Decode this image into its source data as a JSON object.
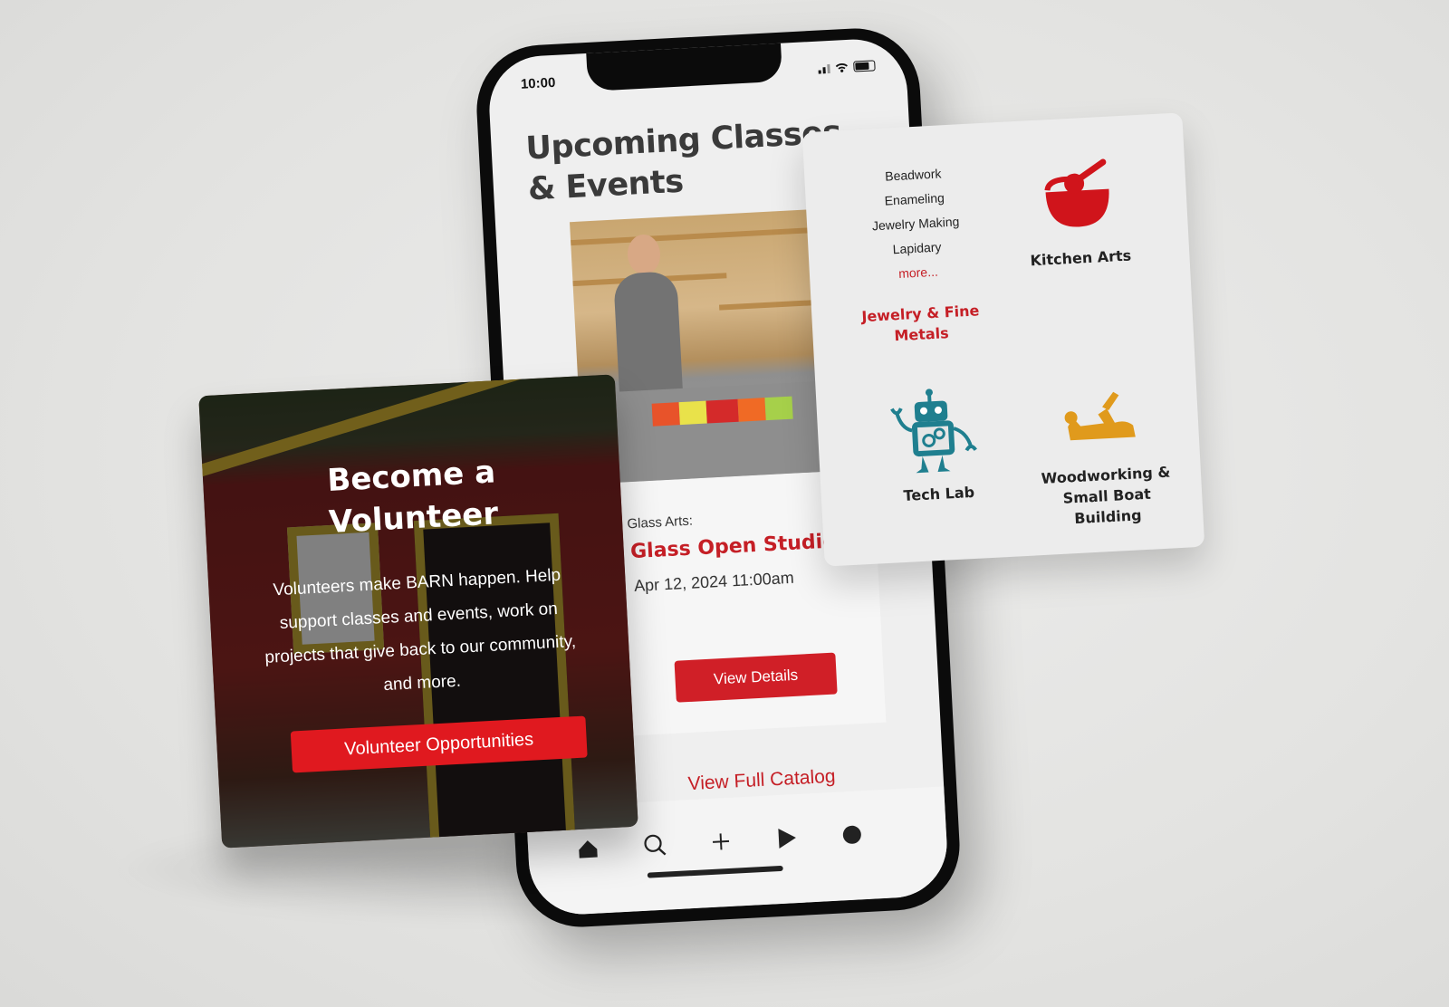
{
  "status_bar": {
    "time": "10:00"
  },
  "screen": {
    "title_line1": "Upcoming Classes",
    "title_line2": "& Events",
    "event": {
      "category": "Glass Arts:",
      "title": "Glass Open Studio",
      "date": "Apr 12, 2024 11:00am",
      "button": "View Details"
    },
    "full_catalog_link": "View Full Catalog"
  },
  "tab_bar": {
    "tabs": [
      {
        "name": "home",
        "icon": "home-icon"
      },
      {
        "name": "search",
        "icon": "search-icon"
      },
      {
        "name": "add",
        "icon": "plus-icon"
      },
      {
        "name": "play",
        "icon": "play-icon"
      },
      {
        "name": "profile",
        "icon": "circle-icon"
      }
    ]
  },
  "categories": {
    "jewelry_subcategories": [
      "Beadwork",
      "Enameling",
      "Jewelry Making",
      "Lapidary"
    ],
    "more_link": "more...",
    "items": [
      {
        "label_line1": "Jewelry & Fine",
        "label_line2": "Metals",
        "color": "#c51f26"
      },
      {
        "label_line1": "Kitchen Arts",
        "icon": "mixing-bowl-icon",
        "color": "#d0141b"
      },
      {
        "label_line1": "Tech Lab",
        "icon": "robot-icon",
        "color": "#1f7f8f"
      },
      {
        "label_line1": "Woodworking &",
        "label_line2": "Small Boat",
        "label_line3": "Building",
        "icon": "hand-plane-icon",
        "color": "#e09a1c"
      }
    ]
  },
  "volunteer": {
    "title_line1": "Become a",
    "title_line2": "Volunteer",
    "body": "Volunteers make BARN happen. Help support classes and events, work on projects that give back to our community, and more.",
    "button": "Volunteer Opportunities"
  },
  "colors": {
    "accent_red": "#d01f27",
    "text_dark": "#3a3a3a"
  }
}
